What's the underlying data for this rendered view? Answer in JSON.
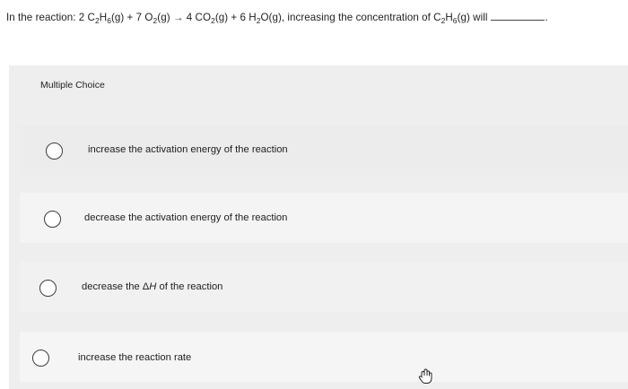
{
  "question": {
    "prefix": "In the reaction: 2 C",
    "r1_sub1": "2",
    "r1_mid": "H",
    "r1_sub2": "6",
    "r1_state": "(g) + 7 O",
    "o2_sub": "2",
    "o2_state": "(g) → 4 CO",
    "co2_sub": "2",
    "co2_state": "(g) + 6 H",
    "h2o_sub": "2",
    "h2o_state": "O(g), increasing the concentration of C",
    "tail_sub1": "2",
    "tail_mid": "H",
    "tail_sub2": "6",
    "tail_end": "(g) will",
    "period": "."
  },
  "section_label": "Multiple Choice",
  "options": [
    {
      "text": "increase the activation energy of the reaction"
    },
    {
      "text": "decrease the activation energy of the reaction"
    },
    {
      "text_before": "decrease the ",
      "delta": "Δ",
      "italic_h": "H",
      "text_after": " of the reaction"
    },
    {
      "text": "increase the reaction rate"
    }
  ],
  "cursor_icon": "hand-pointer-icon"
}
